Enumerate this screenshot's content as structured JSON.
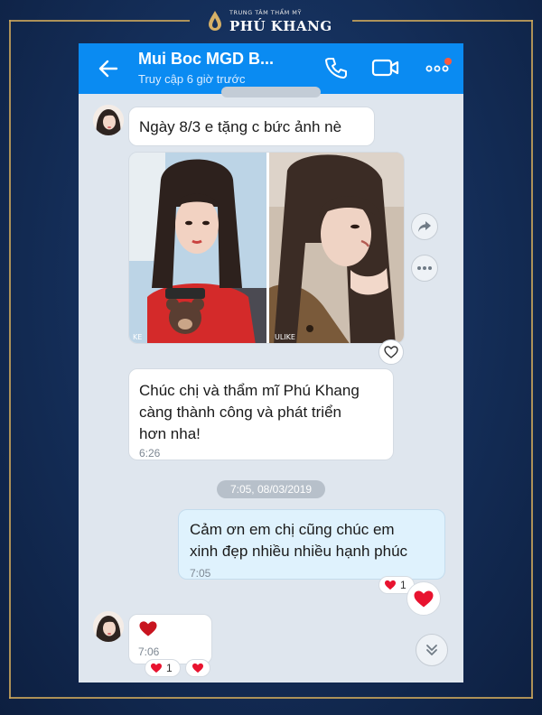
{
  "brand": {
    "subtitle": "TRUNG TÂM THẨM MỸ",
    "name": "PHÚ KHANG"
  },
  "header": {
    "title": "Mui Boc MGD B...",
    "status": "Truy cập 6 giờ trước"
  },
  "messages": [
    {
      "side": "left",
      "text": "Ngày 8/3 e tặng c bức ảnh nè",
      "time": ""
    },
    {
      "side": "left",
      "type": "photos",
      "watermarks": [
        "KE",
        "ULIKE"
      ]
    },
    {
      "side": "left",
      "lines": [
        "Chúc chị và thẩm mĩ Phú Khang",
        "càng thành công và phát triển",
        "hơn nha!"
      ],
      "time": "6:26"
    },
    {
      "type": "date-separator",
      "text": "7:05, 08/03/2019"
    },
    {
      "side": "right",
      "lines": [
        "Cảm ơn em chị cũng chúc em",
        "xinh đẹp nhiều nhiều hạnh phúc"
      ],
      "time": "7:05",
      "reaction_count": "1"
    },
    {
      "side": "left",
      "text": "❤",
      "time": "7:06",
      "reaction_count": "1"
    }
  ],
  "colors": {
    "header": "#0a8bf2",
    "chat_bg": "#dfe6ee",
    "sent_bubble": "#dff2fd",
    "heart": "#e8132f",
    "frame_gold": "#c9a45a"
  },
  "icons": {
    "back": "arrow-left-icon",
    "call": "phone-icon",
    "video": "video-camera-icon",
    "more": "more-dots-icon",
    "share": "share-icon",
    "scroll": "chevron-double-down-icon"
  }
}
